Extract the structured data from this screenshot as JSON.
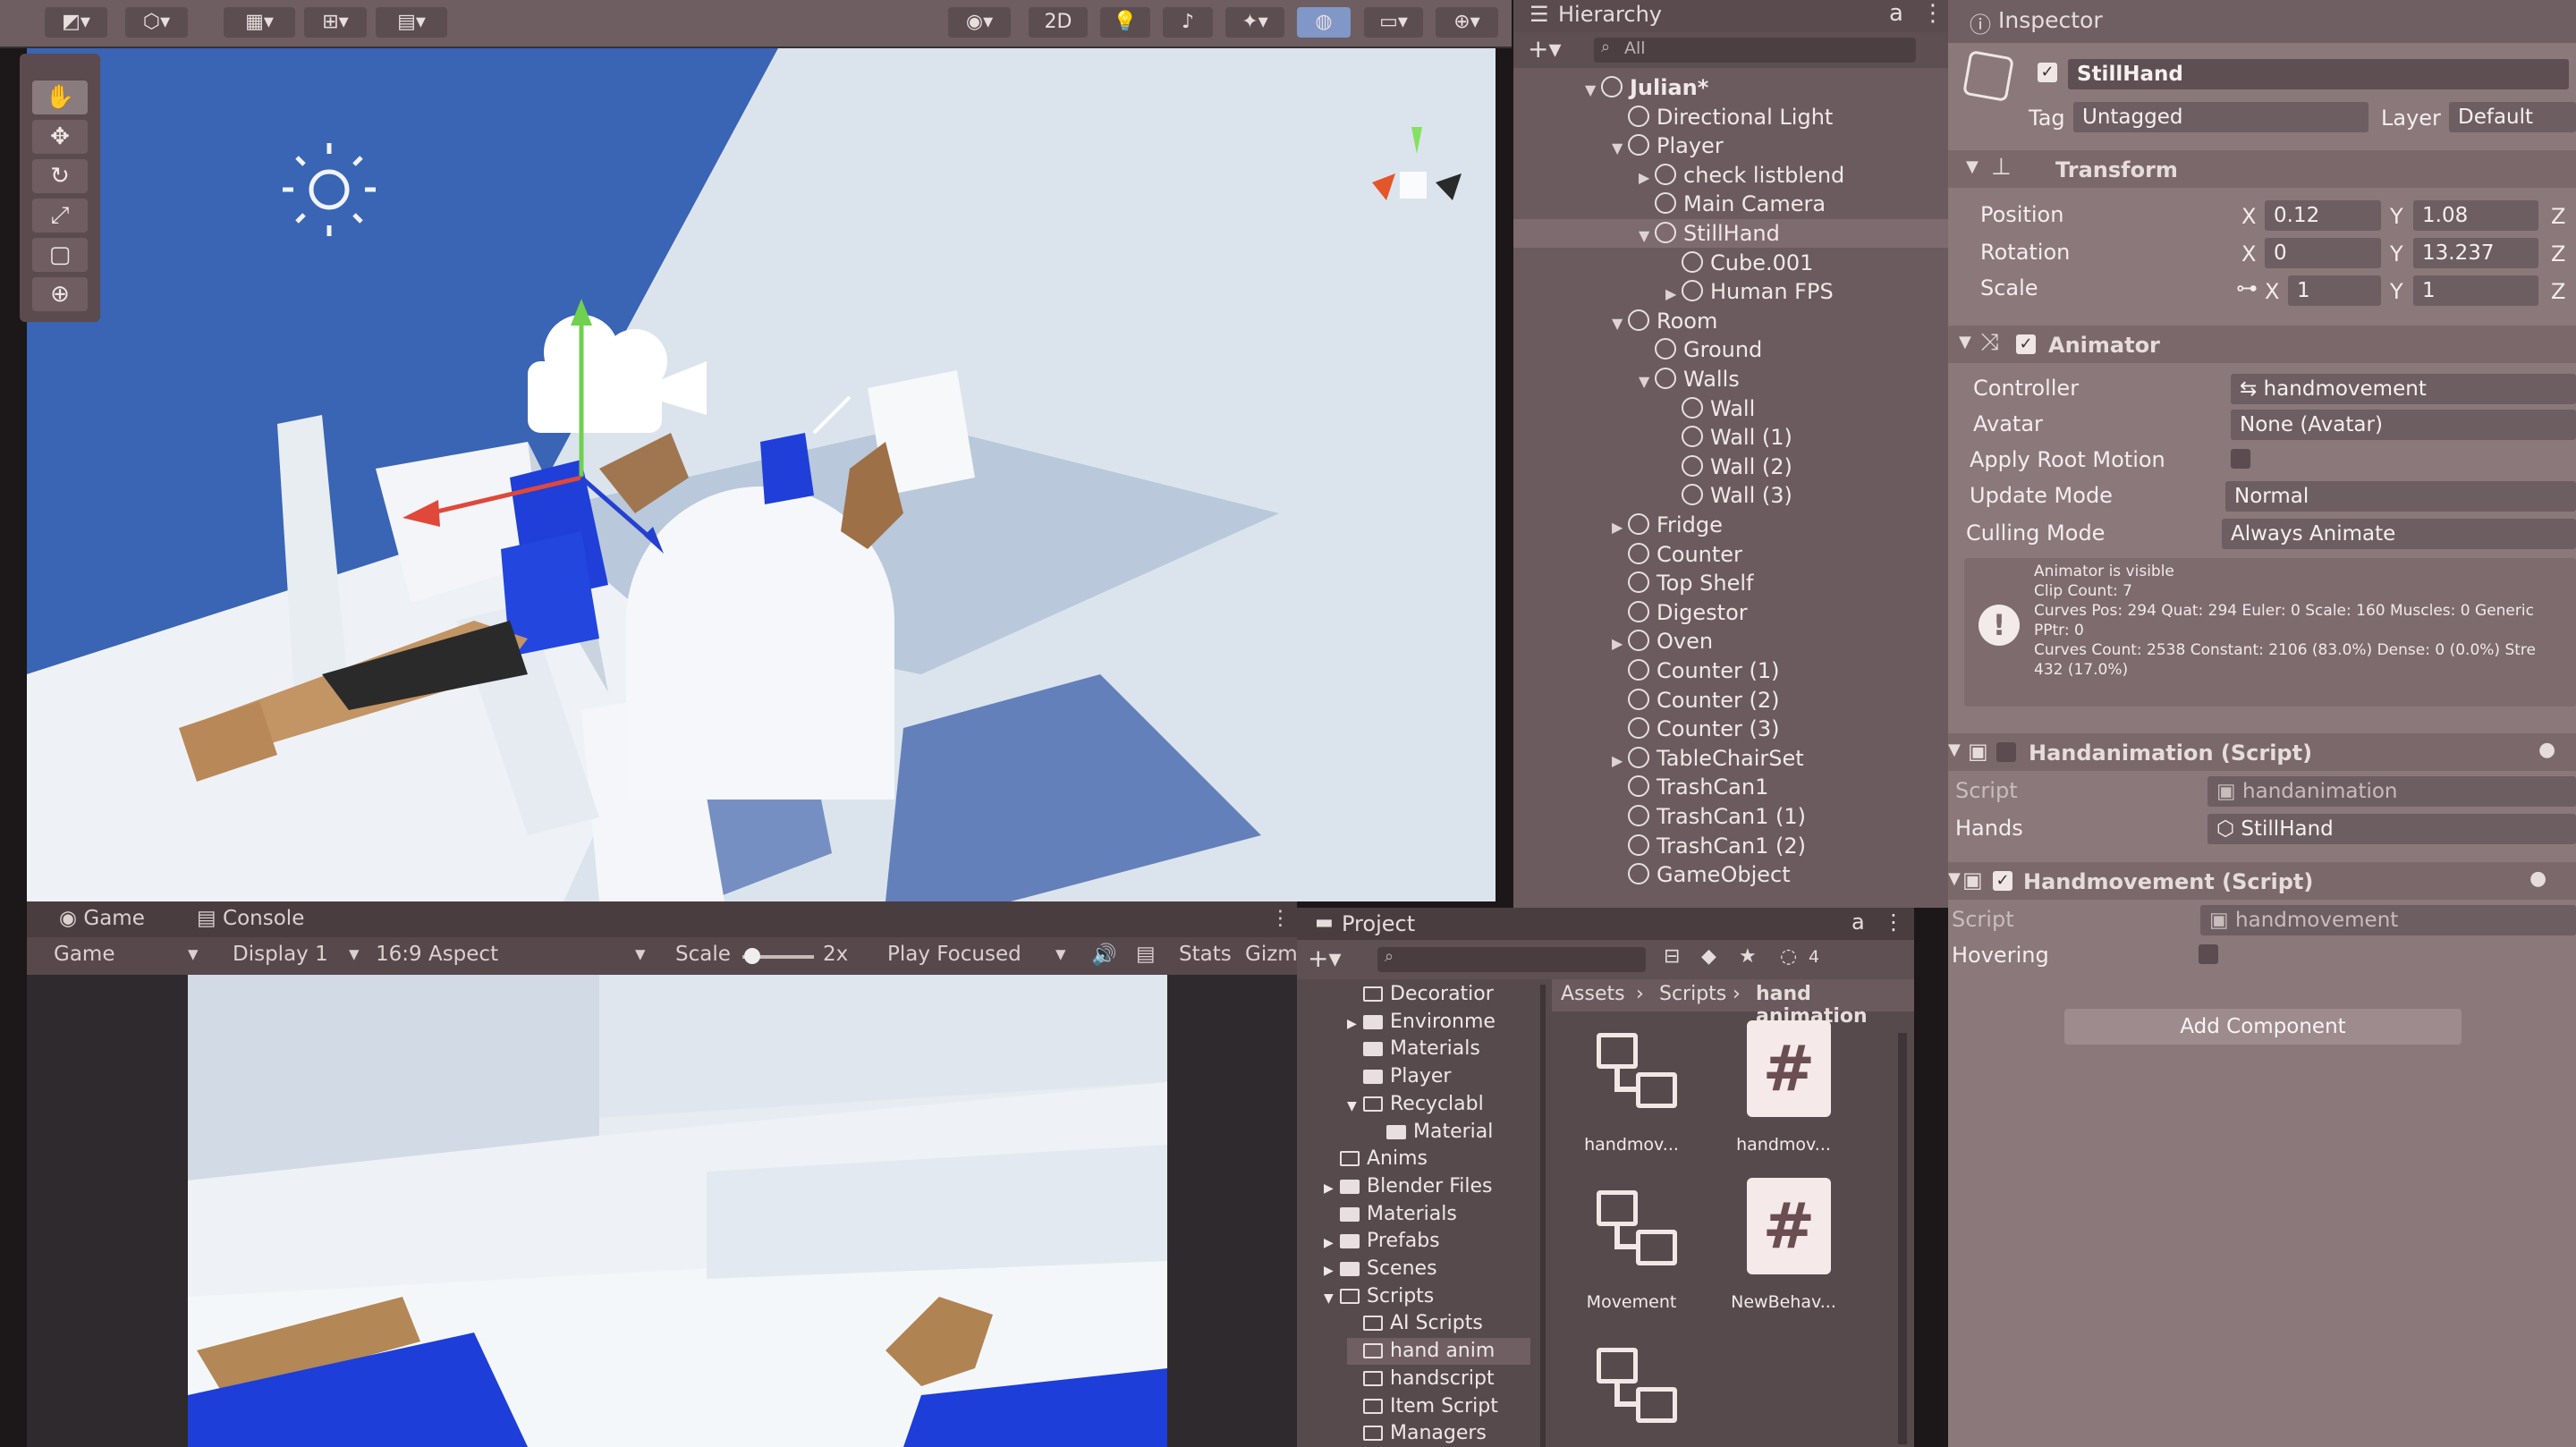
{
  "scene": {
    "toolbar": {
      "mode_2d": "2D"
    },
    "tools": [
      "hand-tool",
      "move-tool",
      "rotate-tool",
      "scale-tool",
      "rect-tool",
      "transform-tool"
    ]
  },
  "game": {
    "tabs": {
      "game": "Game",
      "console": "Console"
    },
    "toolbar": {
      "view": "Game",
      "display": "Display 1",
      "aspect": "16:9 Aspect",
      "scale_label": "Scale",
      "scale_value": "2x",
      "play_mode": "Play Focused",
      "stats": "Stats",
      "gizmos": "Gizm"
    }
  },
  "hierarchy": {
    "tab": "Hierarchy",
    "search_placeholder": "All",
    "items": [
      {
        "label": "Julian*",
        "depth": 0,
        "arrow": "▼",
        "kind": "scene"
      },
      {
        "label": "Directional Light",
        "depth": 1,
        "arrow": ""
      },
      {
        "label": "Player",
        "depth": 1,
        "arrow": "▼"
      },
      {
        "label": "check listblend",
        "depth": 2,
        "arrow": "▶"
      },
      {
        "label": "Main Camera",
        "depth": 2,
        "arrow": ""
      },
      {
        "label": "StillHand",
        "depth": 2,
        "arrow": "▼",
        "selected": true
      },
      {
        "label": "Cube.001",
        "depth": 3,
        "arrow": ""
      },
      {
        "label": "Human FPS",
        "depth": 3,
        "arrow": "▶"
      },
      {
        "label": "Room",
        "depth": 1,
        "arrow": "▼"
      },
      {
        "label": "Ground",
        "depth": 2,
        "arrow": ""
      },
      {
        "label": "Walls",
        "depth": 2,
        "arrow": "▼"
      },
      {
        "label": "Wall",
        "depth": 3,
        "arrow": ""
      },
      {
        "label": "Wall (1)",
        "depth": 3,
        "arrow": ""
      },
      {
        "label": "Wall (2)",
        "depth": 3,
        "arrow": ""
      },
      {
        "label": "Wall (3)",
        "depth": 3,
        "arrow": ""
      },
      {
        "label": "Fridge",
        "depth": 1,
        "arrow": "▶"
      },
      {
        "label": "Counter",
        "depth": 1,
        "arrow": ""
      },
      {
        "label": "Top Shelf",
        "depth": 1,
        "arrow": ""
      },
      {
        "label": "Digestor",
        "depth": 1,
        "arrow": ""
      },
      {
        "label": "Oven",
        "depth": 1,
        "arrow": "▶"
      },
      {
        "label": "Counter (1)",
        "depth": 1,
        "arrow": ""
      },
      {
        "label": "Counter (2)",
        "depth": 1,
        "arrow": ""
      },
      {
        "label": "Counter (3)",
        "depth": 1,
        "arrow": ""
      },
      {
        "label": "TableChairSet",
        "depth": 1,
        "arrow": "▶"
      },
      {
        "label": "TrashCan1",
        "depth": 1,
        "arrow": ""
      },
      {
        "label": "TrashCan1 (1)",
        "depth": 1,
        "arrow": ""
      },
      {
        "label": "TrashCan1 (2)",
        "depth": 1,
        "arrow": ""
      },
      {
        "label": "GameObject",
        "depth": 1,
        "arrow": ""
      }
    ]
  },
  "project": {
    "tab": "Project",
    "breadcrumb": {
      "a": "Assets",
      "b": "Scripts",
      "c": "hand animation"
    },
    "folders": [
      {
        "label": "Decoratior",
        "arrow": "",
        "indent": 1
      },
      {
        "label": "Environme",
        "arrow": "▶",
        "indent": 1
      },
      {
        "label": "Materials",
        "arrow": "",
        "indent": 1
      },
      {
        "label": "Player",
        "arrow": "",
        "indent": 1
      },
      {
        "label": "Recyclabl",
        "arrow": "▼",
        "indent": 1
      },
      {
        "label": "Material",
        "arrow": "",
        "indent": 2
      },
      {
        "label": "Anims",
        "arrow": "",
        "indent": 0
      },
      {
        "label": "Blender Files",
        "arrow": "▶",
        "indent": 0
      },
      {
        "label": "Materials",
        "arrow": "",
        "indent": 0
      },
      {
        "label": "Prefabs",
        "arrow": "▶",
        "indent": 0
      },
      {
        "label": "Scenes",
        "arrow": "▶",
        "indent": 0
      },
      {
        "label": "Scripts",
        "arrow": "▼",
        "indent": 0
      },
      {
        "label": "AI Scripts",
        "arrow": "",
        "indent": 1
      },
      {
        "label": "hand anim",
        "arrow": "",
        "indent": 1
      },
      {
        "label": "handscript",
        "arrow": "",
        "indent": 1
      },
      {
        "label": "Item Script",
        "arrow": "",
        "indent": 1
      },
      {
        "label": "Managers",
        "arrow": "",
        "indent": 1
      }
    ],
    "assets": [
      {
        "label": "handmov...",
        "kind": "animator-controller-icon"
      },
      {
        "label": "handmov...",
        "kind": "script-icon"
      },
      {
        "label": "Movement",
        "kind": "animator-controller-icon"
      },
      {
        "label": "NewBehav...",
        "kind": "script-icon"
      },
      {
        "label": "",
        "kind": "animator-controller-icon"
      }
    ],
    "hidden_count": "4"
  },
  "inspector": {
    "tab": "Inspector",
    "object_name": "StillHand",
    "tag_label": "Tag",
    "tag_value": "Untagged",
    "layer_label": "Layer",
    "layer_value": "Default",
    "transform": {
      "title": "Transform",
      "position_label": "Position",
      "rotation_label": "Rotation",
      "scale_label": "Scale",
      "pos": {
        "x": "0.12",
        "y": "1.08"
      },
      "rot": {
        "x": "0",
        "y": "13.237"
      },
      "scl": {
        "x": "1",
        "y": "1"
      },
      "x": "X",
      "y": "Y",
      "z": "Z"
    },
    "animator": {
      "title": "Animator",
      "controller_label": "Controller",
      "controller_value": "handmovement",
      "avatar_label": "Avatar",
      "avatar_value": "None (Avatar)",
      "root_motion_label": "Apply Root Motion",
      "update_mode_label": "Update Mode",
      "update_mode_value": "Normal",
      "culling_label": "Culling Mode",
      "culling_value": "Always Animate",
      "info": {
        "l1": "Animator is visible",
        "l2": "Clip Count: 7",
        "l3": "Curves Pos: 294 Quat: 294 Euler: 0 Scale: 160 Muscles: 0 Generic",
        "l4": "PPtr: 0",
        "l5": "Curves Count: 2538 Constant: 2106 (83.0%) Dense: 0 (0.0%) Stre",
        "l6": "432 (17.0%)"
      }
    },
    "handanimation": {
      "title": "Handanimation (Script)",
      "script_label": "Script",
      "script_value": "handanimation",
      "hands_label": "Hands",
      "hands_value": "StillHand"
    },
    "handmovement": {
      "title": "Handmovement (Script)",
      "script_label": "Script",
      "script_value": "handmovement",
      "hovering_label": "Hovering"
    },
    "add_component": "Add Component"
  },
  "colors": {
    "scene_bg": "#d7e3ef",
    "blue": "#1f3fd8",
    "skin": "#b88a5a",
    "panel": "#6b5b5e",
    "inspector": "#8a787b"
  }
}
